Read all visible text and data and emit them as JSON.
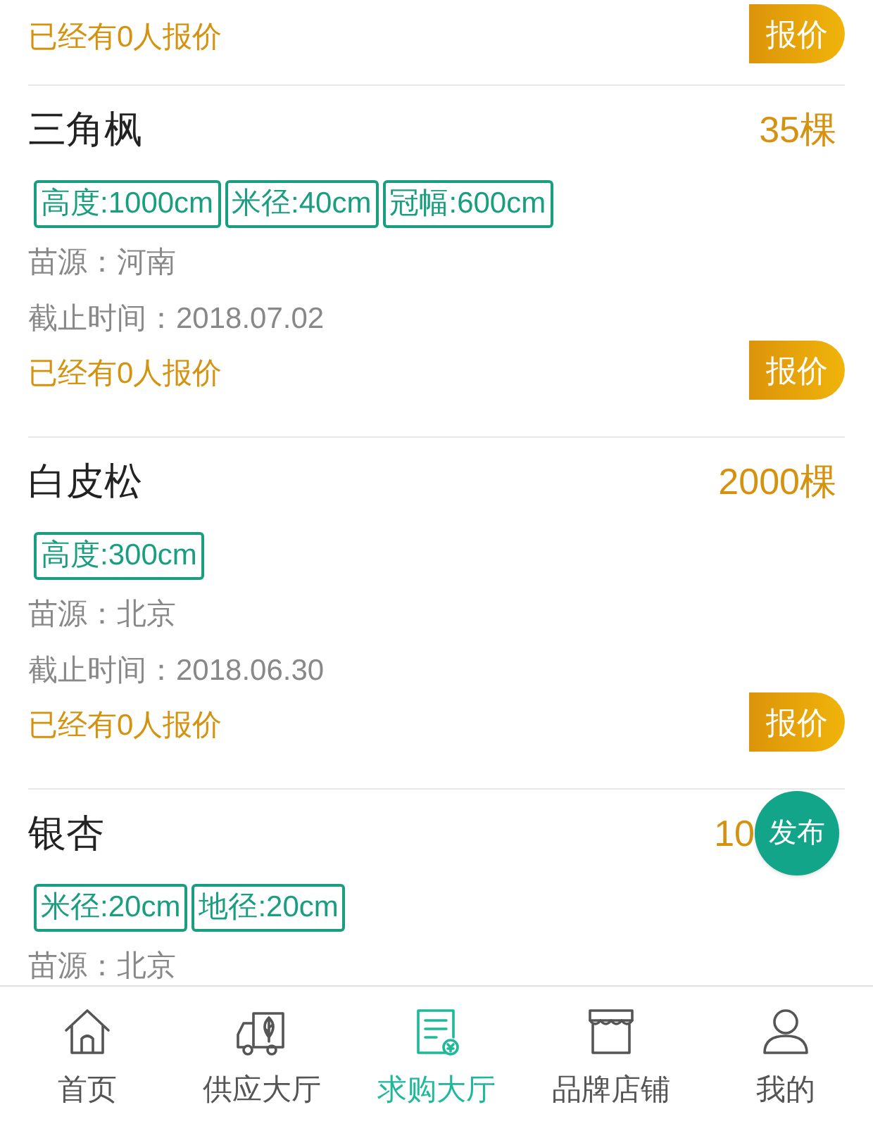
{
  "top_fragment": {
    "quote_count": "已经有0人报价",
    "button": "报价"
  },
  "listings": [
    {
      "name": "三角枫",
      "quantity": "35棵",
      "tags": [
        "高度:1000cm",
        "米径:40cm",
        "冠幅:600cm"
      ],
      "origin": "苗源：河南",
      "deadline": "截止时间：2018.07.02",
      "quote_count": "已经有0人报价",
      "button": "报价"
    },
    {
      "name": "白皮松",
      "quantity": "2000棵",
      "tags": [
        "高度:300cm"
      ],
      "origin": "苗源：北京",
      "deadline": "截止时间：2018.06.30",
      "quote_count": "已经有0人报价",
      "button": "报价"
    },
    {
      "name": "银杏",
      "quantity": "10",
      "tags": [
        "米径:20cm",
        "地径:20cm"
      ],
      "origin": "苗源：北京"
    }
  ],
  "fab": {
    "label": "发布"
  },
  "tab_bar": [
    {
      "kind": "home",
      "label": "首页",
      "selected": false
    },
    {
      "kind": "supply",
      "label": "供应大厅",
      "selected": false
    },
    {
      "kind": "purchase",
      "label": "求购大厅",
      "selected": true
    },
    {
      "kind": "store",
      "label": "品牌店铺",
      "selected": false
    },
    {
      "kind": "profile",
      "label": "我的",
      "selected": false
    }
  ]
}
